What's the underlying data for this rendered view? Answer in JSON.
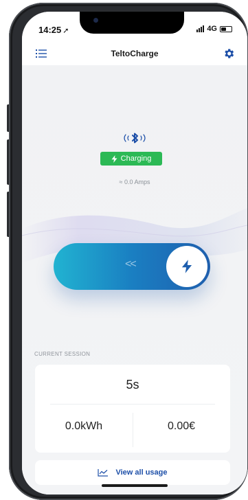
{
  "status_bar": {
    "time": "14:25",
    "network": "4G"
  },
  "header": {
    "title": "TeltoCharge",
    "menu_icon": "list-icon",
    "settings_icon": "gear-icon"
  },
  "charger": {
    "connection_icon": "bluetooth-icon",
    "status_label": "Charging",
    "current": "≈ 0.0 Amps"
  },
  "slider": {
    "arrows": "<<",
    "knob_icon": "lightning-bolt-icon"
  },
  "session": {
    "section_label": "CURRENT SESSION",
    "duration": "5s",
    "energy": "0.0kWh",
    "cost": "0.00€"
  },
  "usage_button": {
    "label": "View all usage",
    "icon": "chart-line-icon"
  },
  "colors": {
    "accent_blue": "#1d4fa8",
    "charging_green": "#2cb955",
    "slider_start": "#21b3d1",
    "slider_end": "#1f5fae"
  }
}
